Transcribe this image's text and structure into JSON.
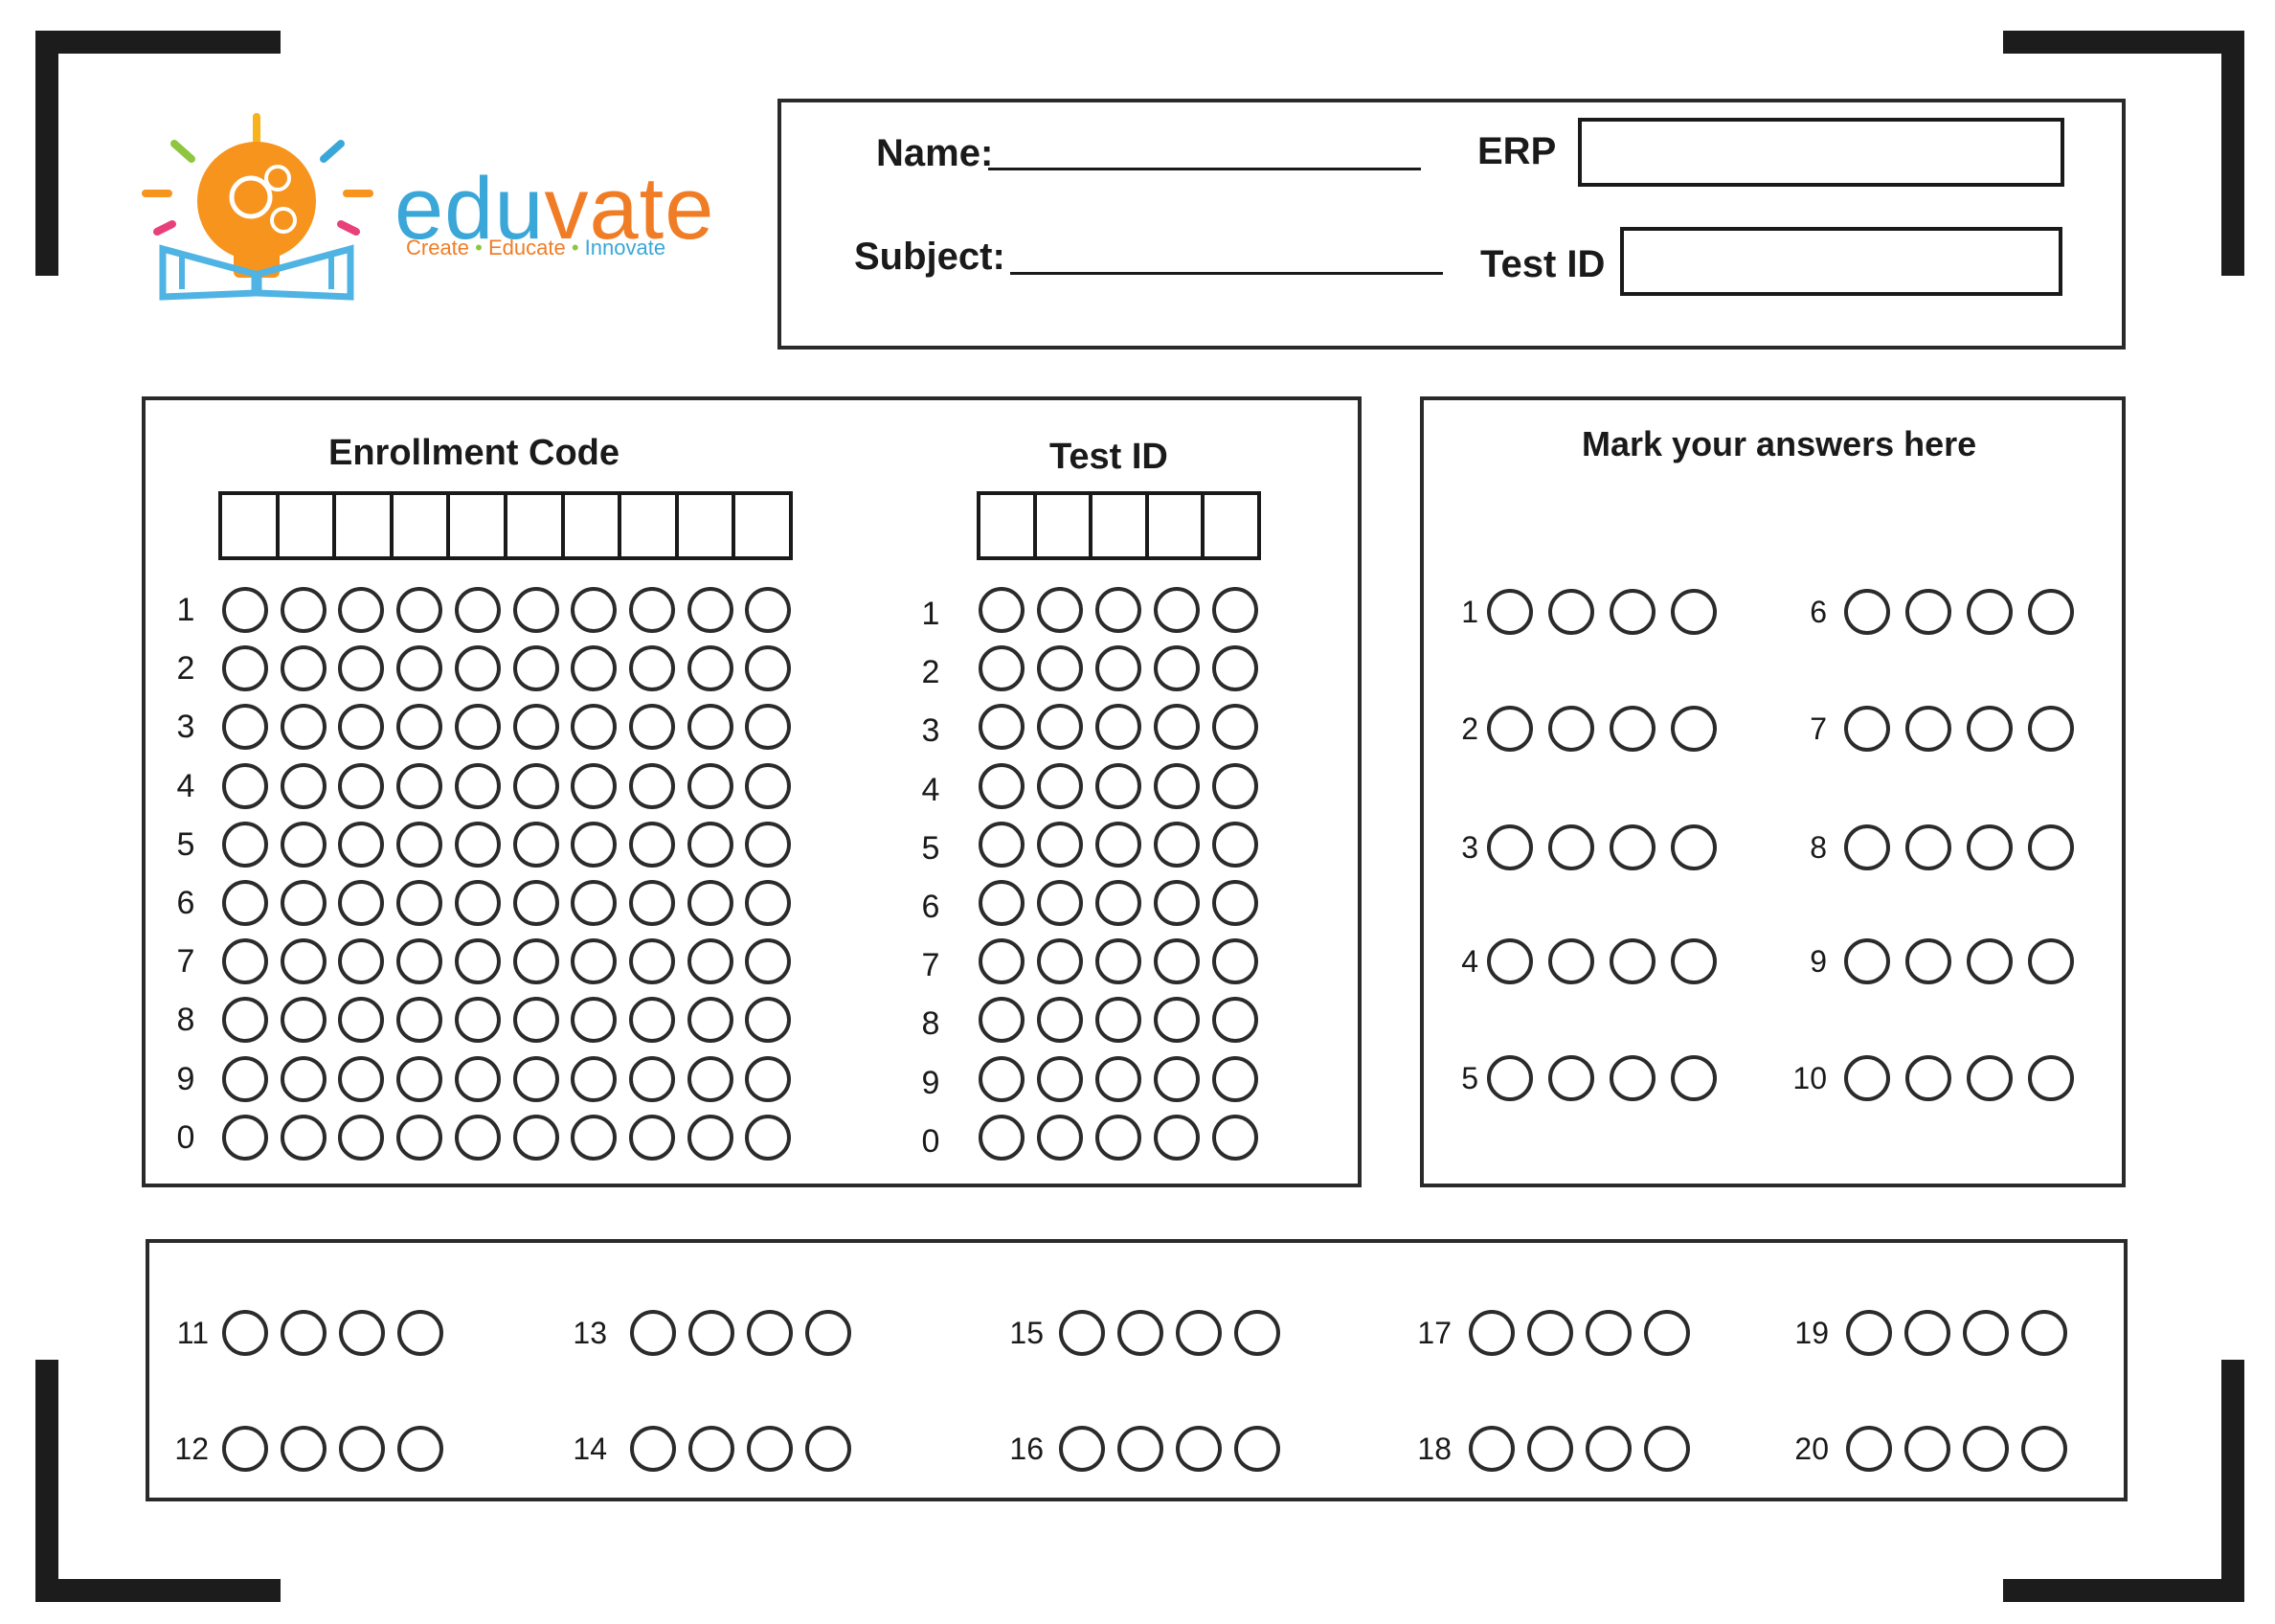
{
  "header": {
    "logo": {
      "name": "eduvate",
      "tagline": [
        "Create",
        "Educate",
        "Innovate"
      ],
      "colors": {
        "edu": "#3aa7d8",
        "vate": "#f07d26",
        "bulb": "#f7941d",
        "book": "#4fb3e3"
      }
    },
    "fields": {
      "name_label": "Name:",
      "subject_label": "Subject:",
      "erp_label": "ERP",
      "test_id_label": "Test ID"
    }
  },
  "enrollment": {
    "title": "Enrollment Code",
    "cells": 10,
    "rows": [
      "1",
      "2",
      "3",
      "4",
      "5",
      "6",
      "7",
      "8",
      "9",
      "0"
    ]
  },
  "test_id": {
    "title": "Test ID",
    "cells": 5,
    "rows": [
      "1",
      "2",
      "3",
      "4",
      "5",
      "6",
      "7",
      "8",
      "9",
      "0"
    ]
  },
  "answers": {
    "title": "Mark your answers here",
    "options_per_question": 4,
    "questions_right_panel": [
      "1",
      "2",
      "3",
      "4",
      "5",
      "6",
      "7",
      "8",
      "9",
      "10"
    ],
    "questions_bottom_panel": [
      "11",
      "12",
      "13",
      "14",
      "15",
      "16",
      "17",
      "18",
      "19",
      "20"
    ]
  }
}
